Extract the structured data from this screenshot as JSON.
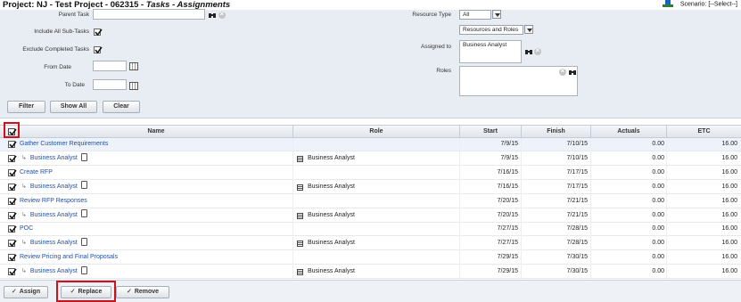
{
  "header": {
    "title_prefix": "Project: NJ - Test Project - 062315 - ",
    "title_italic": "Tasks - Assignments",
    "scenario": "Scenario: [--Select--]"
  },
  "filters": {
    "parent_task_label": "Parent Task",
    "parent_task_value": "",
    "include_subtasks_label": "Include All Sub-Tasks",
    "include_subtasks_checked": true,
    "exclude_completed_label": "Exclude Completed Tasks",
    "exclude_completed_checked": true,
    "from_date_label": "From Date",
    "from_date_value": "",
    "to_date_label": "To Date",
    "to_date_value": "",
    "resource_type_label": "Resource Type",
    "resource_type_value": "All",
    "resources_roles_value": "Resources and Roles",
    "assigned_to_label": "Assigned to",
    "assigned_to_value": "Business Analyst",
    "roles_label": "Roles",
    "roles_value": ""
  },
  "buttons": {
    "filter": "Filter",
    "show_all": "Show All",
    "clear": "Clear",
    "assign": "Assign",
    "replace": "Replace",
    "remove": "Remove"
  },
  "grid": {
    "columns": {
      "name": "Name",
      "role": "Role",
      "start": "Start",
      "finish": "Finish",
      "actuals": "Actuals",
      "etc": "ETC"
    },
    "rows": [
      {
        "type": "task",
        "name": "Gather Customer Requirements",
        "role": "",
        "start": "7/9/15",
        "finish": "7/10/15",
        "actuals": "0.00",
        "etc": "16.00"
      },
      {
        "type": "assignment",
        "name": "Business Analyst",
        "role": "Business Analyst",
        "start": "7/9/15",
        "finish": "7/10/15",
        "actuals": "0.00",
        "etc": "16.00"
      },
      {
        "type": "task",
        "name": "Create RFP",
        "role": "",
        "start": "7/16/15",
        "finish": "7/17/15",
        "actuals": "0.00",
        "etc": "16.00"
      },
      {
        "type": "assignment",
        "name": "Business Analyst",
        "role": "Business Analyst",
        "start": "7/16/15",
        "finish": "7/17/15",
        "actuals": "0.00",
        "etc": "16.00"
      },
      {
        "type": "task",
        "name": "Review RFP Responses",
        "role": "",
        "start": "7/20/15",
        "finish": "7/21/15",
        "actuals": "0.00",
        "etc": "16.00"
      },
      {
        "type": "assignment",
        "name": "Business Analyst",
        "role": "Business Analyst",
        "start": "7/20/15",
        "finish": "7/21/15",
        "actuals": "0.00",
        "etc": "16.00"
      },
      {
        "type": "task",
        "name": "POC",
        "role": "",
        "start": "7/27/15",
        "finish": "7/28/15",
        "actuals": "0.00",
        "etc": "16.00"
      },
      {
        "type": "assignment",
        "name": "Business Analyst",
        "role": "Business Analyst",
        "start": "7/27/15",
        "finish": "7/28/15",
        "actuals": "0.00",
        "etc": "16.00"
      },
      {
        "type": "task",
        "name": "Review Pricing and Final Proposals",
        "role": "",
        "start": "7/29/15",
        "finish": "7/30/15",
        "actuals": "0.00",
        "etc": "16.00"
      },
      {
        "type": "assignment",
        "name": "Business Analyst",
        "role": "Business Analyst",
        "start": "7/29/15",
        "finish": "7/30/15",
        "actuals": "0.00",
        "etc": "16.00"
      }
    ]
  },
  "colors": {
    "highlight": "#d0111b",
    "link": "#1f4fa8",
    "panel": "#e8edf3"
  }
}
